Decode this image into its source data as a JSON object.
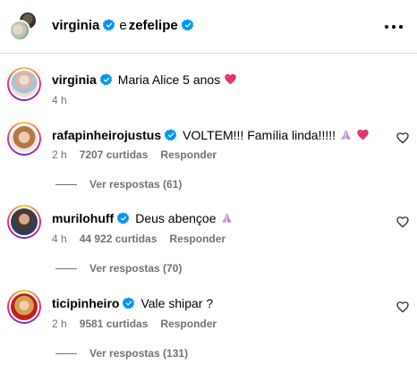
{
  "header": {
    "user": "virginia",
    "connector": "e",
    "collaborator": "zefelipe"
  },
  "caption": {
    "username": "virginia",
    "text": "Maria Alice 5 anos",
    "time": "4 h"
  },
  "comments": [
    {
      "username": "rafapinheirojustus",
      "text": "VOLTEM!!! Família linda!!!!!",
      "time": "2 h",
      "likes": "7207 curtidas",
      "reply": "Responder",
      "replies": "Ver respostas (61)"
    },
    {
      "username": "murilohuff",
      "text": "Deus abençoe",
      "time": "4 h",
      "likes": "44 922 curtidas",
      "reply": "Responder",
      "replies": "Ver respostas (70)"
    },
    {
      "username": "ticipinheiro",
      "text": "Vale shipar ?",
      "time": "2 h",
      "likes": "9581 curtidas",
      "reply": "Responder",
      "replies": "Ver respostas (131)"
    }
  ],
  "colors": {
    "verified": "#0095f6",
    "pink_heart": "#e8336e",
    "secondary_text": "#737373"
  },
  "icons": {
    "verified": "verified-badge-icon",
    "more": "more-options-icon",
    "like": "heart-outline-icon",
    "pray": "praying-hands-emoji",
    "heart": "pink-heart-emoji"
  }
}
